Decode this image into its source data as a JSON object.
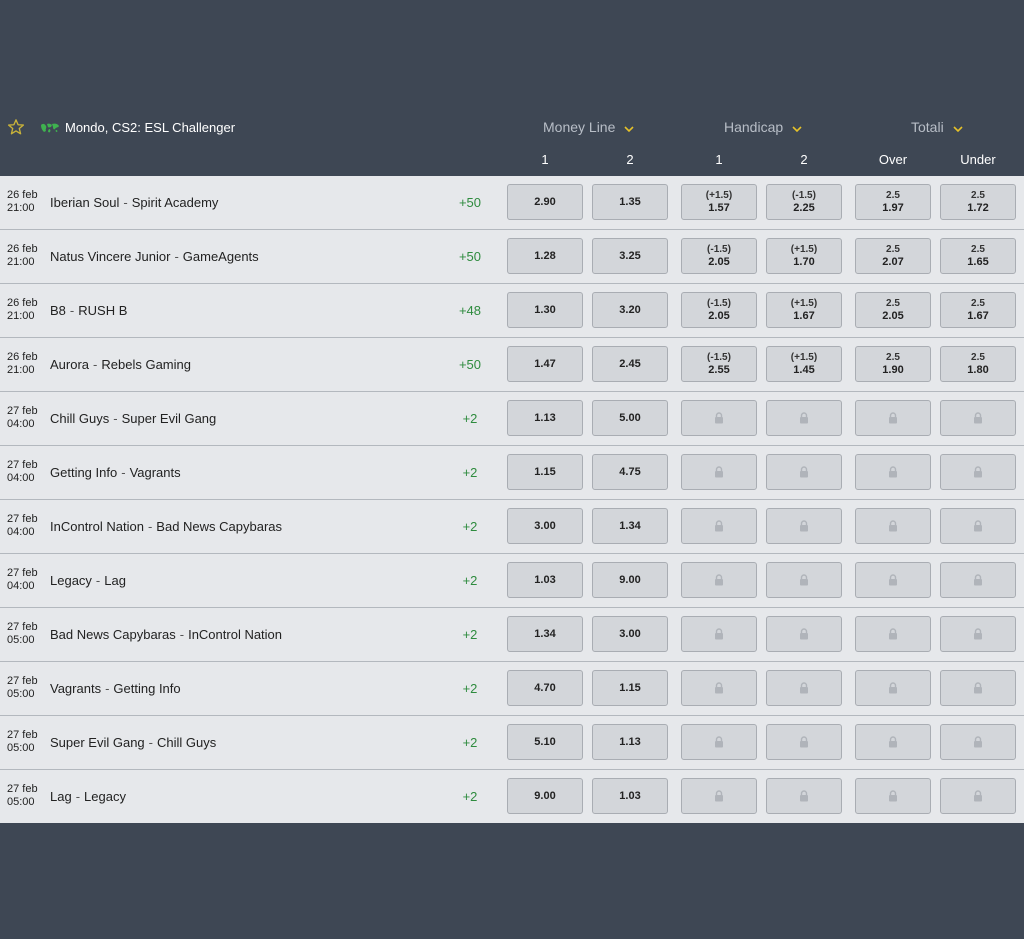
{
  "league": {
    "name": "Mondo, CS2: ESL Challenger",
    "star_icon": "star-icon",
    "flag_icon": "globe-icon"
  },
  "markets": [
    {
      "label": "Money Line",
      "icon": "chevron-down-icon"
    },
    {
      "label": "Handicap",
      "icon": "chevron-down-icon"
    },
    {
      "label": "Totali",
      "icon": "chevron-down-icon"
    }
  ],
  "columns": [
    "1",
    "2",
    "1",
    "2",
    "Over",
    "Under"
  ],
  "colors": {
    "background": "#3e4754",
    "row": "#e6e8eb",
    "odd_box": "#d3d6da",
    "more_text": "#2e8b3e",
    "chevron": "#e6c229"
  },
  "matches": [
    {
      "date": "26 feb",
      "time": "21:00",
      "home": "Iberian Soul",
      "away": "Spirit Academy",
      "more": "+50",
      "ml": [
        "2.90",
        "1.35"
      ],
      "hcp": [
        {
          "line": "(+1.5)",
          "odd": "1.57"
        },
        {
          "line": "(-1.5)",
          "odd": "2.25"
        }
      ],
      "tot": [
        {
          "line": "2.5",
          "odd": "1.97"
        },
        {
          "line": "2.5",
          "odd": "1.72"
        }
      ]
    },
    {
      "date": "26 feb",
      "time": "21:00",
      "home": "Natus Vincere Junior",
      "away": "GameAgents",
      "more": "+50",
      "ml": [
        "1.28",
        "3.25"
      ],
      "hcp": [
        {
          "line": "(-1.5)",
          "odd": "2.05"
        },
        {
          "line": "(+1.5)",
          "odd": "1.70"
        }
      ],
      "tot": [
        {
          "line": "2.5",
          "odd": "2.07"
        },
        {
          "line": "2.5",
          "odd": "1.65"
        }
      ]
    },
    {
      "date": "26 feb",
      "time": "21:00",
      "home": "B8",
      "away": "RUSH B",
      "more": "+48",
      "ml": [
        "1.30",
        "3.20"
      ],
      "hcp": [
        {
          "line": "(-1.5)",
          "odd": "2.05"
        },
        {
          "line": "(+1.5)",
          "odd": "1.67"
        }
      ],
      "tot": [
        {
          "line": "2.5",
          "odd": "2.05"
        },
        {
          "line": "2.5",
          "odd": "1.67"
        }
      ]
    },
    {
      "date": "26 feb",
      "time": "21:00",
      "home": "Aurora",
      "away": "Rebels Gaming",
      "more": "+50",
      "ml": [
        "1.47",
        "2.45"
      ],
      "hcp": [
        {
          "line": "(-1.5)",
          "odd": "2.55"
        },
        {
          "line": "(+1.5)",
          "odd": "1.45"
        }
      ],
      "tot": [
        {
          "line": "2.5",
          "odd": "1.90"
        },
        {
          "line": "2.5",
          "odd": "1.80"
        }
      ]
    },
    {
      "date": "27 feb",
      "time": "04:00",
      "home": "Chill Guys",
      "away": "Super Evil Gang",
      "more": "+2",
      "ml": [
        "1.13",
        "5.00"
      ],
      "hcp": null,
      "tot": null
    },
    {
      "date": "27 feb",
      "time": "04:00",
      "home": "Getting Info",
      "away": "Vagrants",
      "more": "+2",
      "ml": [
        "1.15",
        "4.75"
      ],
      "hcp": null,
      "tot": null
    },
    {
      "date": "27 feb",
      "time": "04:00",
      "home": "InControl Nation",
      "away": "Bad News Capybaras",
      "more": "+2",
      "ml": [
        "3.00",
        "1.34"
      ],
      "hcp": null,
      "tot": null
    },
    {
      "date": "27 feb",
      "time": "04:00",
      "home": "Legacy",
      "away": "Lag",
      "more": "+2",
      "ml": [
        "1.03",
        "9.00"
      ],
      "hcp": null,
      "tot": null
    },
    {
      "date": "27 feb",
      "time": "05:00",
      "home": "Bad News Capybaras",
      "away": "InControl Nation",
      "more": "+2",
      "ml": [
        "1.34",
        "3.00"
      ],
      "hcp": null,
      "tot": null
    },
    {
      "date": "27 feb",
      "time": "05:00",
      "home": "Vagrants",
      "away": "Getting Info",
      "more": "+2",
      "ml": [
        "4.70",
        "1.15"
      ],
      "hcp": null,
      "tot": null
    },
    {
      "date": "27 feb",
      "time": "05:00",
      "home": "Super Evil Gang",
      "away": "Chill Guys",
      "more": "+2",
      "ml": [
        "5.10",
        "1.13"
      ],
      "hcp": null,
      "tot": null
    },
    {
      "date": "27 feb",
      "time": "05:00",
      "home": "Lag",
      "away": "Legacy",
      "more": "+2",
      "ml": [
        "9.00",
        "1.03"
      ],
      "hcp": null,
      "tot": null
    }
  ]
}
